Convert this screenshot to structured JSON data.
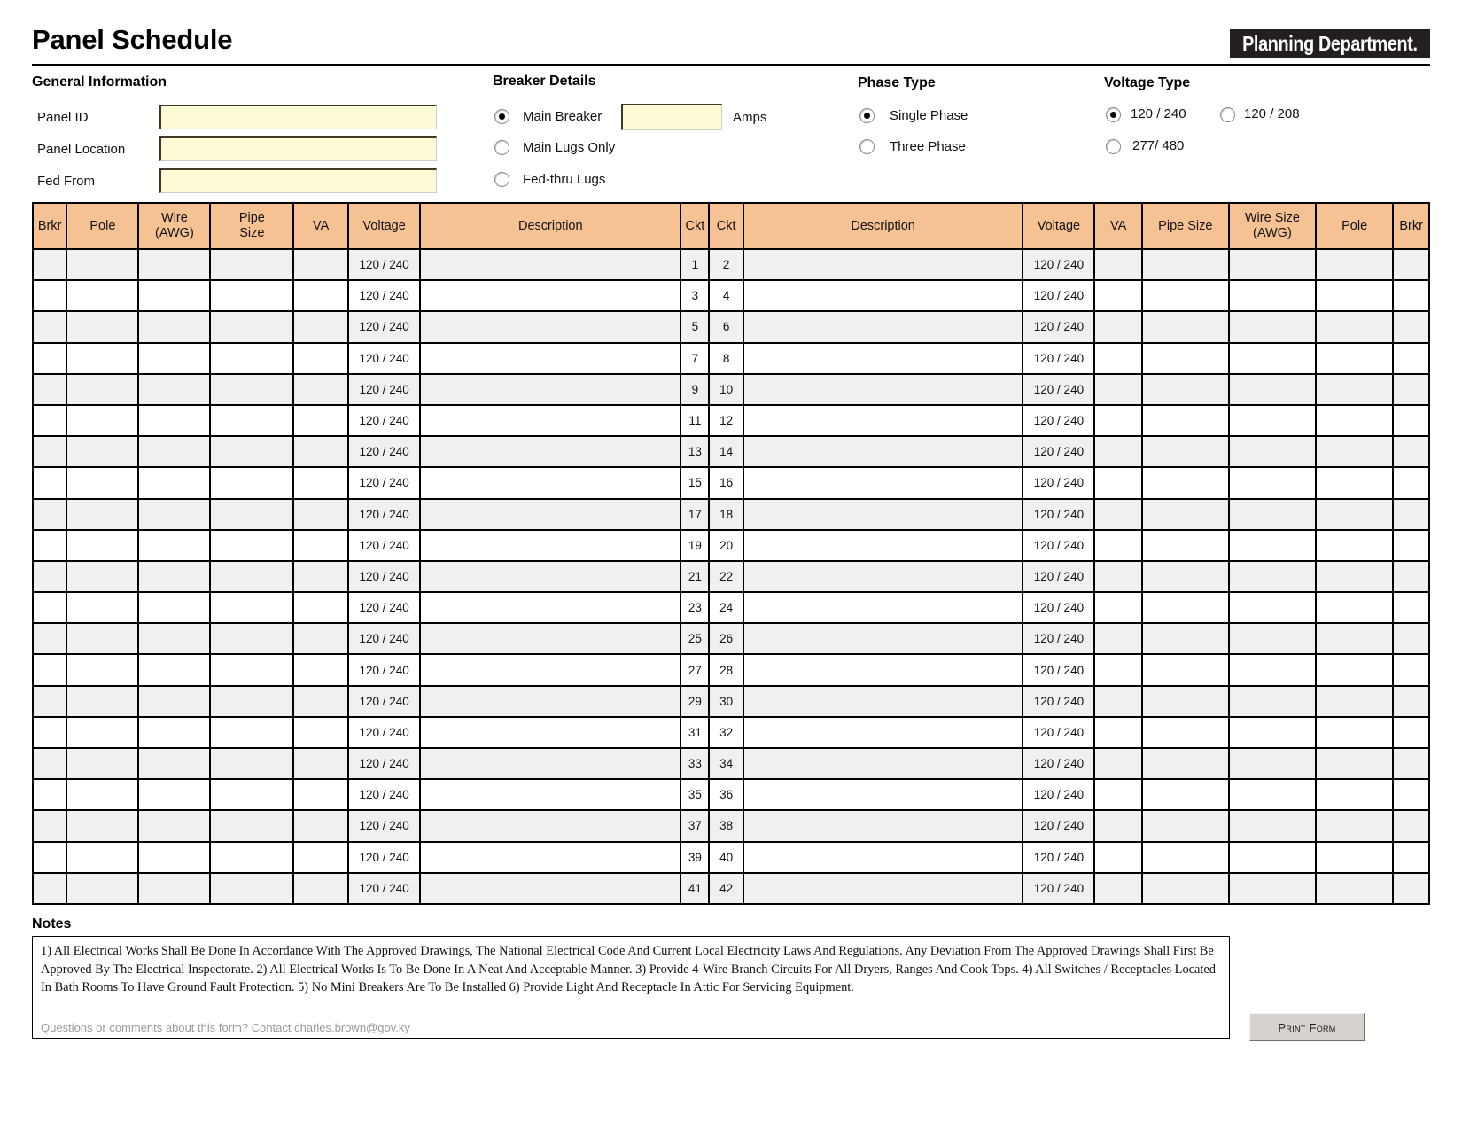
{
  "header": {
    "title": "Panel Schedule",
    "logo_text": "Planning Department."
  },
  "general_information": {
    "heading": "General Information",
    "fields": [
      {
        "label": "Panel ID",
        "value": "",
        "placeholder": ""
      },
      {
        "label": "Panel Location",
        "value": "",
        "placeholder": ""
      },
      {
        "label": "Fed From",
        "value": "",
        "placeholder": ""
      }
    ]
  },
  "breaker_details": {
    "heading": "Breaker Details",
    "options": [
      {
        "label": "Main Breaker",
        "selected": true
      },
      {
        "label": "Main Lugs Only",
        "selected": false
      },
      {
        "label": "Fed-thru Lugs",
        "selected": false
      }
    ],
    "amps_value": "",
    "amps_unit": "Amps"
  },
  "phase_type": {
    "heading": "Phase Type",
    "options": [
      {
        "label": "Single Phase",
        "selected": true
      },
      {
        "label": "Three Phase",
        "selected": false
      }
    ]
  },
  "voltage_type": {
    "heading": "Voltage Type",
    "options": [
      {
        "label": "120 / 240",
        "selected": true
      },
      {
        "label": "120 / 208",
        "selected": false
      },
      {
        "label": "277/ 480",
        "selected": false
      }
    ]
  },
  "schedule": {
    "columns": [
      "Brkr",
      "Pole",
      "Wire (AWG)",
      "Pipe Size",
      "VA",
      "Voltage",
      "Description",
      "Ckt",
      "Ckt",
      "Description",
      "Voltage",
      "VA",
      "Pipe Size",
      "Wire Size (AWG)",
      "Pole",
      "Brkr"
    ],
    "columns_multiline": [
      [
        "Brkr"
      ],
      [
        "Pole"
      ],
      [
        "Wire",
        "(AWG)"
      ],
      [
        "Pipe",
        "Size"
      ],
      [
        "VA"
      ],
      [
        "Voltage"
      ],
      [
        "Description"
      ],
      [
        "Ckt"
      ],
      [
        "Ckt"
      ],
      [
        "Description"
      ],
      [
        "Voltage"
      ],
      [
        "VA"
      ],
      [
        "Pipe Size"
      ],
      [
        "Wire Size",
        "(AWG)"
      ],
      [
        "Pole"
      ],
      [
        "Brkr"
      ]
    ],
    "default_voltage": "120 / 240",
    "rows": [
      {
        "brkr_l": "",
        "pole_l": "",
        "wire_l": "",
        "pipe_l": "",
        "va_l": "",
        "volt_l": "120 / 240",
        "desc_l": "",
        "ckt_l": "1",
        "ckt_r": "2",
        "desc_r": "",
        "volt_r": "120 / 240",
        "va_r": "",
        "pipe_r": "",
        "wire_r": "",
        "pole_r": "",
        "brkr_r": ""
      },
      {
        "brkr_l": "",
        "pole_l": "",
        "wire_l": "",
        "pipe_l": "",
        "va_l": "",
        "volt_l": "120 / 240",
        "desc_l": "",
        "ckt_l": "3",
        "ckt_r": "4",
        "desc_r": "",
        "volt_r": "120 / 240",
        "va_r": "",
        "pipe_r": "",
        "wire_r": "",
        "pole_r": "",
        "brkr_r": ""
      },
      {
        "brkr_l": "",
        "pole_l": "",
        "wire_l": "",
        "pipe_l": "",
        "va_l": "",
        "volt_l": "120 / 240",
        "desc_l": "",
        "ckt_l": "5",
        "ckt_r": "6",
        "desc_r": "",
        "volt_r": "120 / 240",
        "va_r": "",
        "pipe_r": "",
        "wire_r": "",
        "pole_r": "",
        "brkr_r": ""
      },
      {
        "brkr_l": "",
        "pole_l": "",
        "wire_l": "",
        "pipe_l": "",
        "va_l": "",
        "volt_l": "120 / 240",
        "desc_l": "",
        "ckt_l": "7",
        "ckt_r": "8",
        "desc_r": "",
        "volt_r": "120 / 240",
        "va_r": "",
        "pipe_r": "",
        "wire_r": "",
        "pole_r": "",
        "brkr_r": ""
      },
      {
        "brkr_l": "",
        "pole_l": "",
        "wire_l": "",
        "pipe_l": "",
        "va_l": "",
        "volt_l": "120 / 240",
        "desc_l": "",
        "ckt_l": "9",
        "ckt_r": "10",
        "desc_r": "",
        "volt_r": "120 / 240",
        "va_r": "",
        "pipe_r": "",
        "wire_r": "",
        "pole_r": "",
        "brkr_r": ""
      },
      {
        "brkr_l": "",
        "pole_l": "",
        "wire_l": "",
        "pipe_l": "",
        "va_l": "",
        "volt_l": "120 / 240",
        "desc_l": "",
        "ckt_l": "11",
        "ckt_r": "12",
        "desc_r": "",
        "volt_r": "120 / 240",
        "va_r": "",
        "pipe_r": "",
        "wire_r": "",
        "pole_r": "",
        "brkr_r": ""
      },
      {
        "brkr_l": "",
        "pole_l": "",
        "wire_l": "",
        "pipe_l": "",
        "va_l": "",
        "volt_l": "120 / 240",
        "desc_l": "",
        "ckt_l": "13",
        "ckt_r": "14",
        "desc_r": "",
        "volt_r": "120 / 240",
        "va_r": "",
        "pipe_r": "",
        "wire_r": "",
        "pole_r": "",
        "brkr_r": ""
      },
      {
        "brkr_l": "",
        "pole_l": "",
        "wire_l": "",
        "pipe_l": "",
        "va_l": "",
        "volt_l": "120 / 240",
        "desc_l": "",
        "ckt_l": "15",
        "ckt_r": "16",
        "desc_r": "",
        "volt_r": "120 / 240",
        "va_r": "",
        "pipe_r": "",
        "wire_r": "",
        "pole_r": "",
        "brkr_r": ""
      },
      {
        "brkr_l": "",
        "pole_l": "",
        "wire_l": "",
        "pipe_l": "",
        "va_l": "",
        "volt_l": "120 / 240",
        "desc_l": "",
        "ckt_l": "17",
        "ckt_r": "18",
        "desc_r": "",
        "volt_r": "120 / 240",
        "va_r": "",
        "pipe_r": "",
        "wire_r": "",
        "pole_r": "",
        "brkr_r": ""
      },
      {
        "brkr_l": "",
        "pole_l": "",
        "wire_l": "",
        "pipe_l": "",
        "va_l": "",
        "volt_l": "120 / 240",
        "desc_l": "",
        "ckt_l": "19",
        "ckt_r": "20",
        "desc_r": "",
        "volt_r": "120 / 240",
        "va_r": "",
        "pipe_r": "",
        "wire_r": "",
        "pole_r": "",
        "brkr_r": ""
      },
      {
        "brkr_l": "",
        "pole_l": "",
        "wire_l": "",
        "pipe_l": "",
        "va_l": "",
        "volt_l": "120 / 240",
        "desc_l": "",
        "ckt_l": "21",
        "ckt_r": "22",
        "desc_r": "",
        "volt_r": "120 / 240",
        "va_r": "",
        "pipe_r": "",
        "wire_r": "",
        "pole_r": "",
        "brkr_r": ""
      },
      {
        "brkr_l": "",
        "pole_l": "",
        "wire_l": "",
        "pipe_l": "",
        "va_l": "",
        "volt_l": "120 / 240",
        "desc_l": "",
        "ckt_l": "23",
        "ckt_r": "24",
        "desc_r": "",
        "volt_r": "120 / 240",
        "va_r": "",
        "pipe_r": "",
        "wire_r": "",
        "pole_r": "",
        "brkr_r": ""
      },
      {
        "brkr_l": "",
        "pole_l": "",
        "wire_l": "",
        "pipe_l": "",
        "va_l": "",
        "volt_l": "120 / 240",
        "desc_l": "",
        "ckt_l": "25",
        "ckt_r": "26",
        "desc_r": "",
        "volt_r": "120 / 240",
        "va_r": "",
        "pipe_r": "",
        "wire_r": "",
        "pole_r": "",
        "brkr_r": ""
      },
      {
        "brkr_l": "",
        "pole_l": "",
        "wire_l": "",
        "pipe_l": "",
        "va_l": "",
        "volt_l": "120 / 240",
        "desc_l": "",
        "ckt_l": "27",
        "ckt_r": "28",
        "desc_r": "",
        "volt_r": "120 / 240",
        "va_r": "",
        "pipe_r": "",
        "wire_r": "",
        "pole_r": "",
        "brkr_r": ""
      },
      {
        "brkr_l": "",
        "pole_l": "",
        "wire_l": "",
        "pipe_l": "",
        "va_l": "",
        "volt_l": "120 / 240",
        "desc_l": "",
        "ckt_l": "29",
        "ckt_r": "30",
        "desc_r": "",
        "volt_r": "120 / 240",
        "va_r": "",
        "pipe_r": "",
        "wire_r": "",
        "pole_r": "",
        "brkr_r": ""
      },
      {
        "brkr_l": "",
        "pole_l": "",
        "wire_l": "",
        "pipe_l": "",
        "va_l": "",
        "volt_l": "120 / 240",
        "desc_l": "",
        "ckt_l": "31",
        "ckt_r": "32",
        "desc_r": "",
        "volt_r": "120 / 240",
        "va_r": "",
        "pipe_r": "",
        "wire_r": "",
        "pole_r": "",
        "brkr_r": ""
      },
      {
        "brkr_l": "",
        "pole_l": "",
        "wire_l": "",
        "pipe_l": "",
        "va_l": "",
        "volt_l": "120 / 240",
        "desc_l": "",
        "ckt_l": "33",
        "ckt_r": "34",
        "desc_r": "",
        "volt_r": "120 / 240",
        "va_r": "",
        "pipe_r": "",
        "wire_r": "",
        "pole_r": "",
        "brkr_r": ""
      },
      {
        "brkr_l": "",
        "pole_l": "",
        "wire_l": "",
        "pipe_l": "",
        "va_l": "",
        "volt_l": "120 / 240",
        "desc_l": "",
        "ckt_l": "35",
        "ckt_r": "36",
        "desc_r": "",
        "volt_r": "120 / 240",
        "va_r": "",
        "pipe_r": "",
        "wire_r": "",
        "pole_r": "",
        "brkr_r": ""
      },
      {
        "brkr_l": "",
        "pole_l": "",
        "wire_l": "",
        "pipe_l": "",
        "va_l": "",
        "volt_l": "120 / 240",
        "desc_l": "",
        "ckt_l": "37",
        "ckt_r": "38",
        "desc_r": "",
        "volt_r": "120 / 240",
        "va_r": "",
        "pipe_r": "",
        "wire_r": "",
        "pole_r": "",
        "brkr_r": ""
      },
      {
        "brkr_l": "",
        "pole_l": "",
        "wire_l": "",
        "pipe_l": "",
        "va_l": "",
        "volt_l": "120 / 240",
        "desc_l": "",
        "ckt_l": "39",
        "ckt_r": "40",
        "desc_r": "",
        "volt_r": "120 / 240",
        "va_r": "",
        "pipe_r": "",
        "wire_r": "",
        "pole_r": "",
        "brkr_r": ""
      },
      {
        "brkr_l": "",
        "pole_l": "",
        "wire_l": "",
        "pipe_l": "",
        "va_l": "",
        "volt_l": "120 / 240",
        "desc_l": "",
        "ckt_l": "41",
        "ckt_r": "42",
        "desc_r": "",
        "volt_r": "120 / 240",
        "va_r": "",
        "pipe_r": "",
        "wire_r": "",
        "pole_r": "",
        "brkr_r": ""
      }
    ]
  },
  "notes": {
    "heading": "Notes",
    "text": "1) All Electrical Works Shall Be Done In Accordance With The Approved Drawings, The National Electrical Code And Current Local Electricity Laws And Regulations. Any Deviation From The Approved Drawings Shall First Be Approved By The Electrical Inspectorate. 2) All Electrical Works Is To Be Done In A Neat And Acceptable Manner. 3) Provide 4-Wire Branch Circuits For All Dryers, Ranges And Cook Tops. 4) All Switches / Receptacles Located In Bath Rooms To Have Ground Fault Protection.  5) No Mini Breakers Are To Be Installed  6) Provide Light And Receptacle In Attic For Servicing Equipment."
  },
  "footer": {
    "contact_text": "Questions or comments about this form? Contact charles.brown@gov.ky",
    "print_button": "Print Form"
  },
  "colors": {
    "header_fill": "#f7c293",
    "field_fill": "#fcfbd5",
    "row_alt": "#f0f0f0",
    "logo_bg": "#231f1e",
    "button_bg": "#d6d2ce"
  }
}
